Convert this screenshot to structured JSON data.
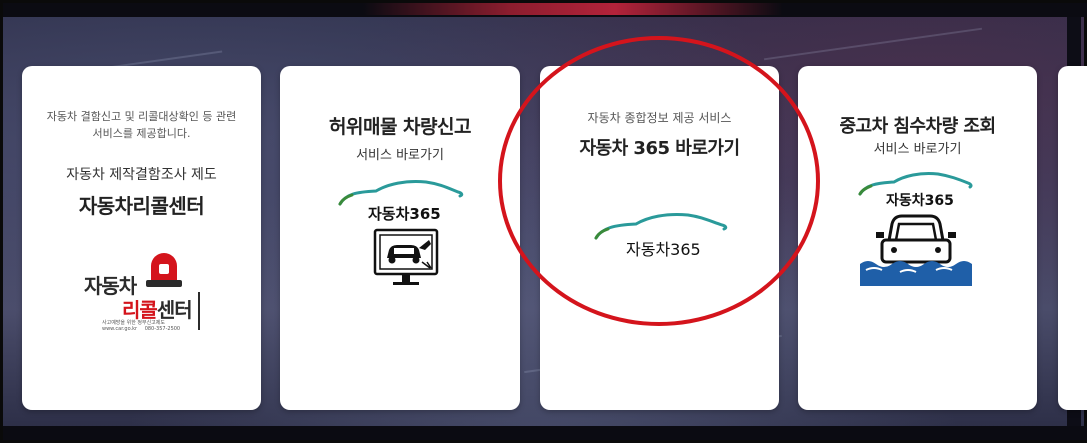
{
  "cards": [
    {
      "desc": "자동차 결함신고 및 리콜대상확인 등 관련\n서비스를 제공합니다.",
      "desc_line1": "자동차 결함신고 및 리콜대상확인 등 관련",
      "desc_line2": "서비스를 제공합니다.",
      "subtitle": "자동차 제작결함조사 제도",
      "title": "자동차리콜센터",
      "logo": {
        "line1": "자동차",
        "line2_red": "리콜",
        "line2_black": "센터",
        "tagline": "사고예방을 위한 정부신고제도",
        "url": "www.car.go.kr",
        "phone": "080-357-2500"
      }
    },
    {
      "title": "허위매물 차량신고",
      "link": "서비스 바로가기",
      "logo_text": "자동차365",
      "icon": "monitor-car-icon"
    },
    {
      "desc": "자동차 종합정보 제공 서비스",
      "title": "자동차 365 바로가기",
      "logo_text": "자동차365"
    },
    {
      "title": "중고차 침수차량 조회",
      "link": "서비스 바로가기",
      "logo_text": "자동차365",
      "icon": "flooded-car-icon"
    }
  ],
  "colors": {
    "accent_red": "#d4141c",
    "logo_teal": "#2a9a9a",
    "logo_green": "#3a8a3a",
    "water_blue": "#1f5fa8"
  }
}
